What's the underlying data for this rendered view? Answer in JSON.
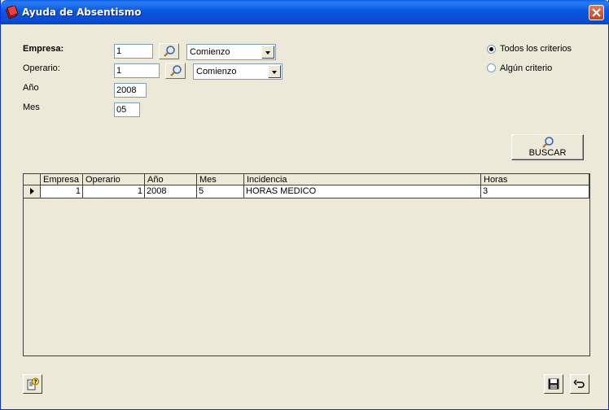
{
  "window": {
    "title": "Ayuda de Absentismo"
  },
  "form": {
    "empresa": {
      "label": "Empresa:",
      "value": "1",
      "combo": "Comienzo"
    },
    "operario": {
      "label": "Operario:",
      "value": "1",
      "combo": "Comienzo"
    },
    "anio": {
      "label": "Año",
      "value": "2008"
    },
    "mes": {
      "label": "Mes",
      "value": "05"
    }
  },
  "criteria": {
    "todos": {
      "label": "Todos los criterios",
      "checked": true
    },
    "alguno": {
      "label": "Algún criterio",
      "checked": false
    }
  },
  "buscar": {
    "label": "BUSCAR"
  },
  "grid": {
    "columns": [
      "Empresa",
      "Operario",
      "Año",
      "Mes",
      "Incidencia",
      "Horas"
    ],
    "rows": [
      [
        "1",
        "1",
        "2008",
        "5",
        "HORAS MEDICO",
        "3"
      ]
    ]
  }
}
